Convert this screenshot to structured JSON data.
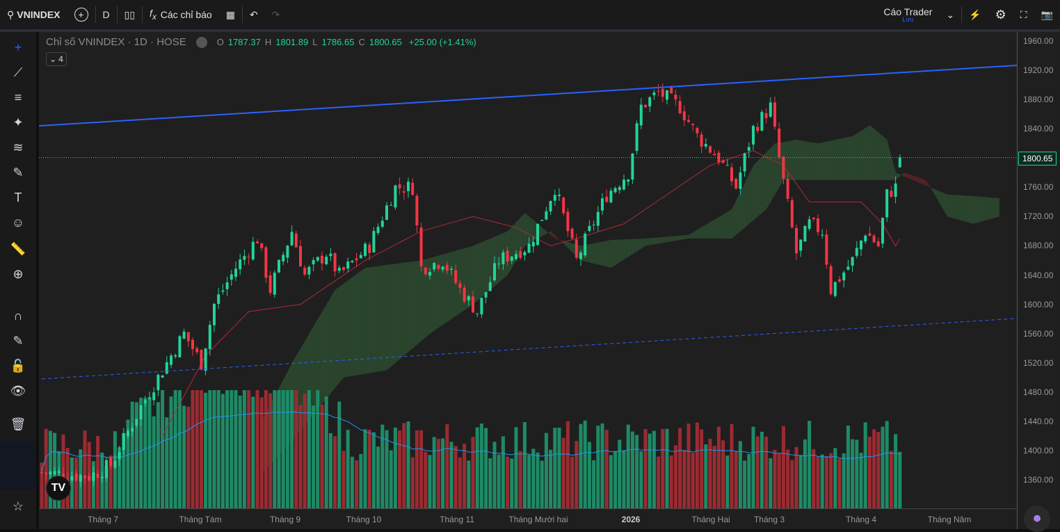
{
  "toolbar": {
    "symbol": "VNINDEX",
    "interval": "D",
    "indicators": "Các chỉ báo",
    "layout_name": "Cáo Trader",
    "layout_status": "Lưu"
  },
  "legend": {
    "title": "Chỉ số VNINDEX · 1D · HOSE",
    "o_label": "O",
    "o": "1787.37",
    "h_label": "H",
    "h": "1801.89",
    "l_label": "L",
    "l": "1786.65",
    "c_label": "C",
    "c": "1800.65",
    "change": "+25.00 (+1.41%)",
    "collapsed_count": "4"
  },
  "colors": {
    "up": "#22d39a",
    "down": "#f23645",
    "vol_up": "#1e8a66",
    "vol_down": "#9b2b31",
    "trend": "#2962ff",
    "cloud_green": "#2d4a2f",
    "cloud_red": "#5a2326"
  },
  "y_axis": {
    "ticks": [
      "1960.00",
      "1920.00",
      "1880.00",
      "1840.00",
      "1800.00",
      "1760.00",
      "1720.00",
      "1680.00",
      "1640.00",
      "1600.00",
      "1560.00",
      "1520.00",
      "1480.00",
      "1440.00",
      "1400.00",
      "1360.00"
    ],
    "last_price": "1800.65"
  },
  "x_axis": {
    "labels": [
      "Tháng 7",
      "Tháng Tám",
      "Tháng 9",
      "Tháng 10",
      "Tháng 11",
      "Tháng Mười hai",
      "2026",
      "Tháng Hai",
      "Tháng 3",
      "Tháng 4",
      "Tháng Năm"
    ]
  },
  "chart_data": {
    "type": "candlestick",
    "title": "Chỉ số VNINDEX · 1D · HOSE",
    "ylim": [
      1340,
      1970
    ],
    "close_path": [
      [
        0,
        1370
      ],
      [
        11,
        1365
      ],
      [
        16,
        1380
      ],
      [
        23,
        1460
      ],
      [
        29,
        1520
      ],
      [
        33,
        1560
      ],
      [
        37,
        1520
      ],
      [
        40,
        1600
      ],
      [
        45,
        1650
      ],
      [
        50,
        1690
      ],
      [
        53,
        1620
      ],
      [
        58,
        1700
      ],
      [
        61,
        1640
      ],
      [
        66,
        1670
      ],
      [
        69,
        1640
      ],
      [
        76,
        1680
      ],
      [
        82,
        1760
      ],
      [
        86,
        1760
      ],
      [
        88,
        1650
      ],
      [
        93,
        1660
      ],
      [
        97,
        1620
      ],
      [
        101,
        1590
      ],
      [
        106,
        1660
      ],
      [
        113,
        1680
      ],
      [
        119,
        1760
      ],
      [
        124,
        1660
      ],
      [
        127,
        1700
      ],
      [
        131,
        1750
      ],
      [
        136,
        1780
      ],
      [
        139,
        1870
      ],
      [
        143,
        1890
      ],
      [
        148,
        1870
      ],
      [
        152,
        1830
      ],
      [
        157,
        1800
      ],
      [
        161,
        1760
      ],
      [
        165,
        1840
      ],
      [
        169,
        1870
      ],
      [
        171,
        1800
      ],
      [
        175,
        1670
      ],
      [
        178,
        1710
      ],
      [
        181,
        1700
      ],
      [
        183,
        1620
      ],
      [
        188,
        1660
      ],
      [
        191,
        1700
      ],
      [
        194,
        1680
      ],
      [
        196,
        1750
      ],
      [
        198,
        1760
      ],
      [
        199,
        1800.65
      ]
    ],
    "span_a": [
      [
        51,
        1440
      ],
      [
        58,
        1520
      ],
      [
        68,
        1620
      ],
      [
        75,
        1650
      ],
      [
        88,
        1660
      ],
      [
        100,
        1680
      ],
      [
        108,
        1700
      ],
      [
        112,
        1725
      ],
      [
        117,
        1700
      ],
      [
        119,
        1690
      ],
      [
        125,
        1680
      ],
      [
        132,
        1688
      ],
      [
        140,
        1690
      ],
      [
        150,
        1695
      ],
      [
        160,
        1730
      ],
      [
        165,
        1790
      ],
      [
        170,
        1820
      ],
      [
        175,
        1825
      ],
      [
        180,
        1820
      ],
      [
        188,
        1830
      ],
      [
        192,
        1845
      ],
      [
        196,
        1825
      ],
      [
        198,
        1780
      ],
      [
        202,
        1770
      ],
      [
        210,
        1750
      ],
      [
        216,
        1748
      ],
      [
        222,
        1745
      ]
    ],
    "span_b": [
      [
        51,
        1370
      ],
      [
        56,
        1400
      ],
      [
        70,
        1500
      ],
      [
        80,
        1510
      ],
      [
        90,
        1560
      ],
      [
        100,
        1600
      ],
      [
        108,
        1640
      ],
      [
        112,
        1680
      ],
      [
        118,
        1700
      ],
      [
        125,
        1660
      ],
      [
        132,
        1650
      ],
      [
        140,
        1680
      ],
      [
        150,
        1690
      ],
      [
        160,
        1690
      ],
      [
        168,
        1730
      ],
      [
        172,
        1770
      ],
      [
        180,
        1770
      ],
      [
        190,
        1770
      ],
      [
        198,
        1770
      ],
      [
        200,
        1780
      ],
      [
        205,
        1770
      ],
      [
        210,
        1720
      ],
      [
        216,
        1710
      ],
      [
        222,
        1720
      ]
    ],
    "base_line": [
      [
        28,
        1420
      ],
      [
        38,
        1530
      ],
      [
        48,
        1590
      ],
      [
        60,
        1600
      ],
      [
        75,
        1660
      ],
      [
        88,
        1700
      ],
      [
        100,
        1720
      ],
      [
        110,
        1705
      ],
      [
        118,
        1680
      ],
      [
        124,
        1690
      ],
      [
        135,
        1710
      ],
      [
        145,
        1750
      ],
      [
        155,
        1790
      ],
      [
        165,
        1810
      ],
      [
        172,
        1790
      ],
      [
        178,
        1740
      ],
      [
        190,
        1740
      ],
      [
        195,
        1710
      ],
      [
        198,
        1680
      ],
      [
        199,
        1690
      ]
    ],
    "trendline_upper": [
      [
        0,
        1844
      ],
      [
        227,
        1927
      ]
    ],
    "trendline_lower": [
      [
        0,
        1498
      ],
      [
        227,
        1581
      ]
    ],
    "last_close": 1800.65
  }
}
